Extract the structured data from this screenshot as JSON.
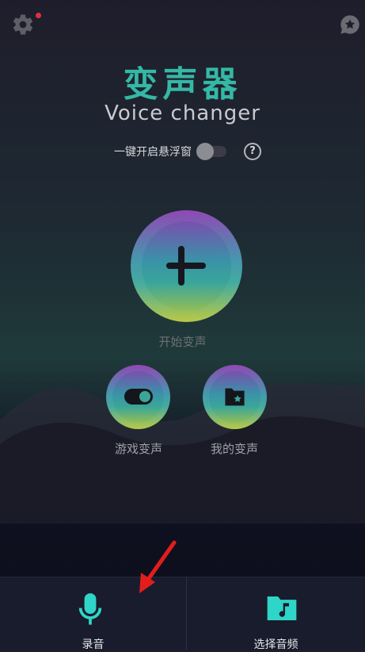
{
  "header": {
    "settings_icon": "gear-icon",
    "favorite_icon": "star-bubble-icon",
    "title_cn": "变声器",
    "title_en": "Voice changer"
  },
  "float_window": {
    "label": "一键开启悬浮窗",
    "enabled": false,
    "help_icon": "?"
  },
  "main": {
    "start_label": "开始变声",
    "game_label": "游戏变声",
    "mine_label": "我的变声"
  },
  "bottom_tabs": [
    {
      "label": "录音",
      "icon": "microphone-icon"
    },
    {
      "label": "选择音频",
      "icon": "music-folder-icon"
    }
  ],
  "colors": {
    "accent": "#35b8a6",
    "badge": "#e0313f",
    "annotation_arrow": "#e21d1d"
  }
}
